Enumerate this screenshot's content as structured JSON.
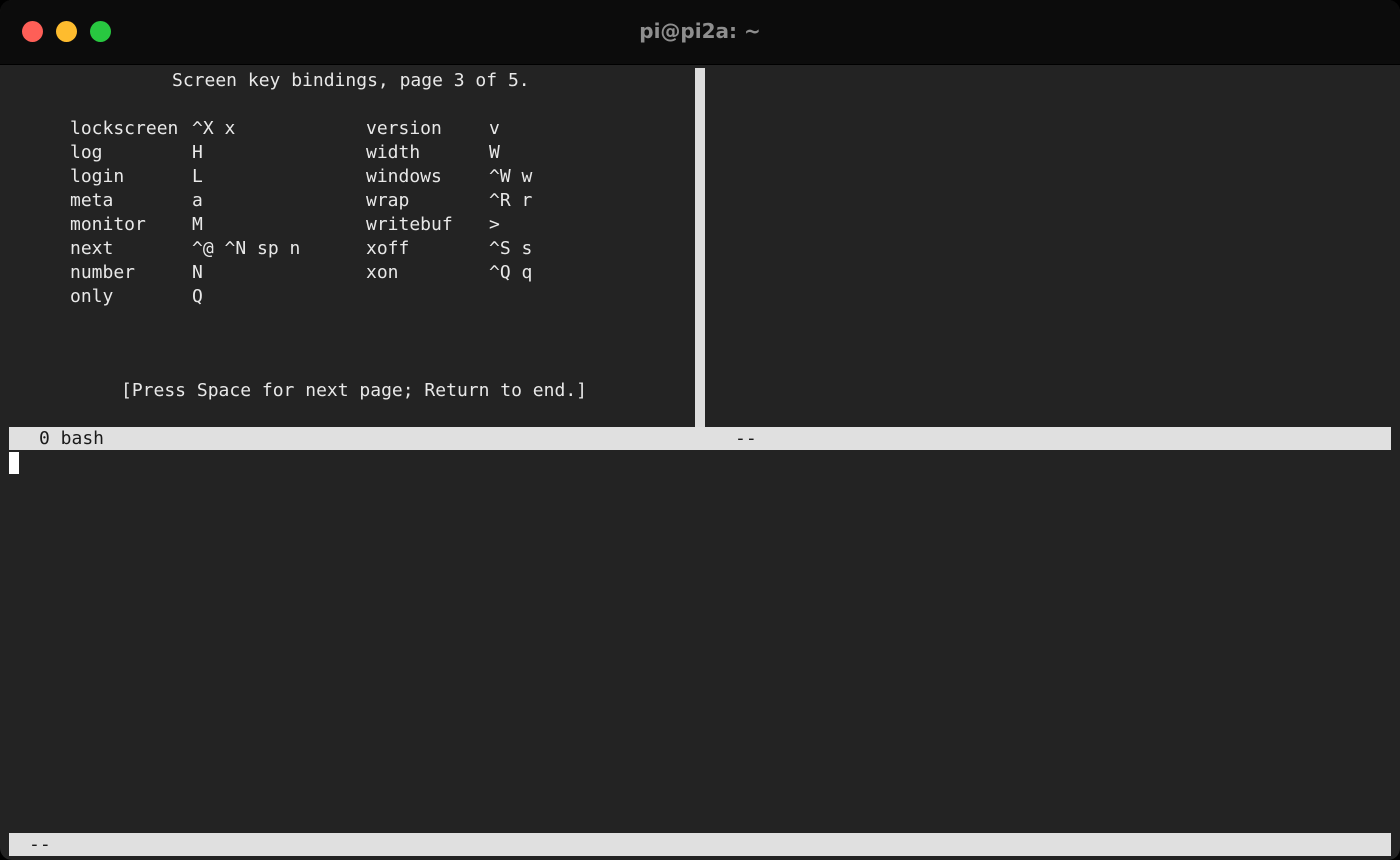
{
  "window": {
    "title": "pi@pi2a: ~"
  },
  "help": {
    "heading": "Screen key bindings, page 3 of 5.",
    "left_column": [
      {
        "command": "lockscreen",
        "keys": "^X x"
      },
      {
        "command": "log",
        "keys": "H"
      },
      {
        "command": "login",
        "keys": "L"
      },
      {
        "command": "meta",
        "keys": "a"
      },
      {
        "command": "monitor",
        "keys": "M"
      },
      {
        "command": "next",
        "keys": "^@ ^N sp n"
      },
      {
        "command": "number",
        "keys": "N"
      },
      {
        "command": "only",
        "keys": "Q"
      }
    ],
    "right_column": [
      {
        "command": "version",
        "keys": "v"
      },
      {
        "command": "width",
        "keys": "W"
      },
      {
        "command": "windows",
        "keys": "^W w"
      },
      {
        "command": "wrap",
        "keys": "^R r"
      },
      {
        "command": "writebuf",
        "keys": ">"
      },
      {
        "command": "xoff",
        "keys": "^S s"
      },
      {
        "command": "xon",
        "keys": "^Q q"
      }
    ],
    "footer": "[Press Space for next page; Return to end.]"
  },
  "status_top": {
    "left": "0 bash",
    "middle": "--"
  },
  "status_bottom": {
    "left": "--"
  },
  "colors": {
    "terminal_bg": "#232323",
    "titlebar_bg": "#0c0c0c",
    "statusbar_bg": "#e0e0e0",
    "close": "#fe5f57",
    "minimize": "#febc2e",
    "zoom": "#28c840"
  }
}
